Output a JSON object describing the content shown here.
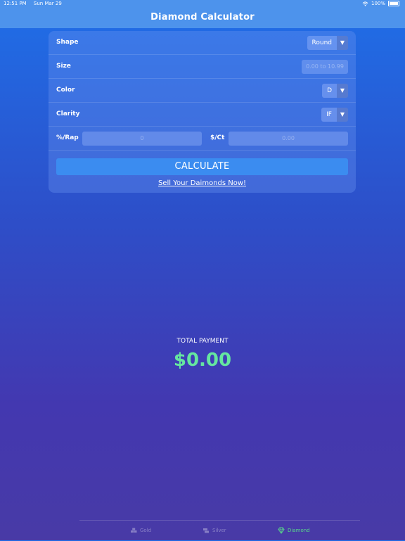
{
  "status": {
    "time": "12:51 PM",
    "date": "Sun Mar 29",
    "battery": "100%"
  },
  "nav": {
    "title": "Diamond Calculator"
  },
  "form": {
    "shape": {
      "label": "Shape",
      "value": "Round"
    },
    "size": {
      "label": "Size",
      "placeholder": "0.00 to 10.99"
    },
    "color": {
      "label": "Color",
      "value": "D"
    },
    "clarity": {
      "label": "Clarity",
      "value": "IF"
    },
    "rap": {
      "label": "%/Rap",
      "placeholder": "0"
    },
    "price_ct": {
      "label": "$/Ct",
      "placeholder": "0.00"
    },
    "calculate_label": "CALCULATE",
    "sell_link": "Sell Your Daimonds Now!"
  },
  "total": {
    "label": "TOTAL PAYMENT",
    "value": "$0.00"
  },
  "tabs": [
    {
      "label": "Gold",
      "icon": "gold-bars-icon",
      "active": false
    },
    {
      "label": "Silver",
      "icon": "silver-bars-icon",
      "active": false
    },
    {
      "label": "Diamond",
      "icon": "diamond-icon",
      "active": true
    }
  ],
  "colors": {
    "accent": "#3b8cf0",
    "total": "#65e6a0",
    "active_tab": "#58d68a"
  }
}
